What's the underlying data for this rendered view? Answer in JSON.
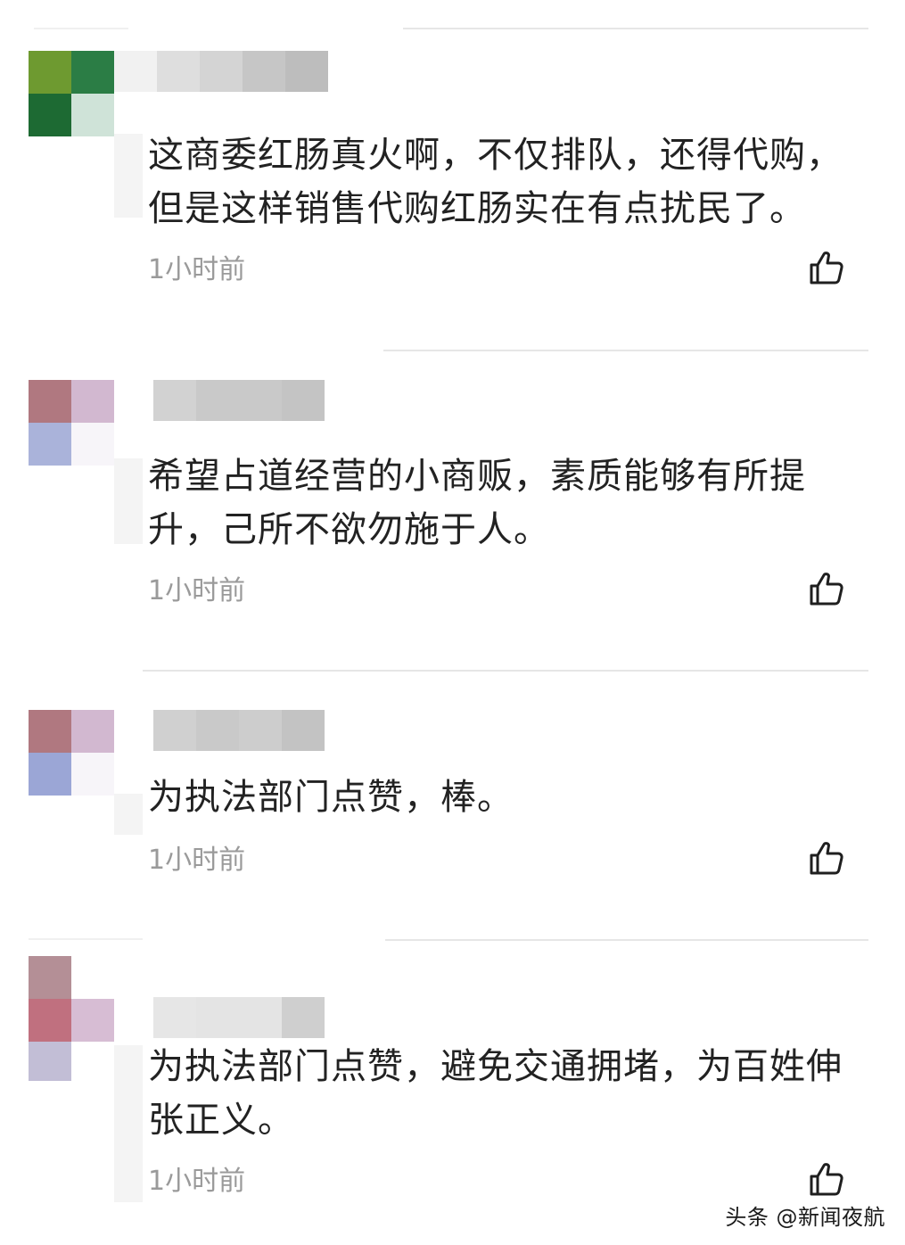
{
  "comments": [
    {
      "text": "这商委红肠真火啊，不仅排队，还得代购，\n但是这样销售代购红肠实在有点扰民了。",
      "time": "1小时前",
      "like_icon": "thumbs-up-icon"
    },
    {
      "text": "希望占道经营的小商贩，素质能够有所提\n升，己所不欲勿施于人。",
      "time": "1小时前",
      "like_icon": "thumbs-up-icon"
    },
    {
      "text": "为执法部门点赞，棒。",
      "time": "1小时前",
      "like_icon": "thumbs-up-icon"
    },
    {
      "text": "为执法部门点赞，避免交通拥堵，为百姓伸\n张正义。",
      "time": "1小时前",
      "like_icon": "thumbs-up-icon"
    }
  ],
  "watermark": "头条 @新闻夜航"
}
